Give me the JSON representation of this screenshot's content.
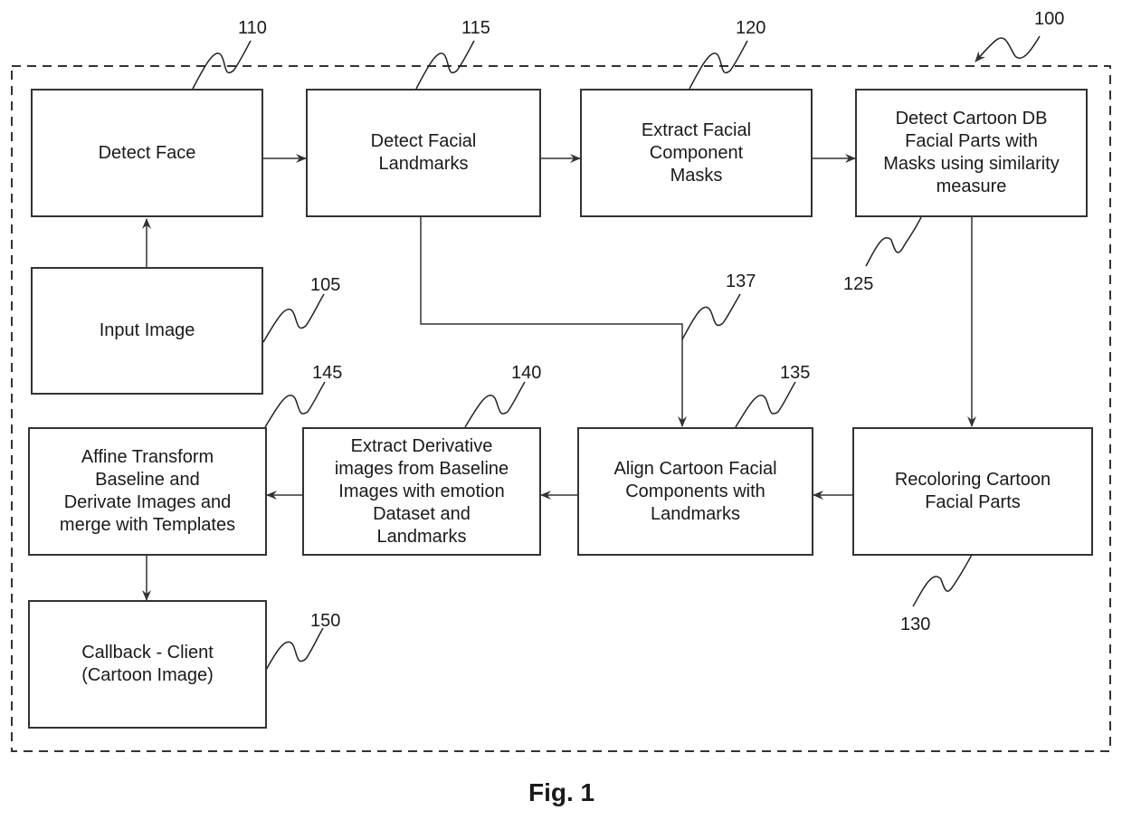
{
  "figure": {
    "caption": "Fig. 1",
    "system_ref": "100",
    "nodes": [
      {
        "id": "110",
        "label": "Detect Face"
      },
      {
        "id": "115",
        "label": "Detect Facial\nLandmarks"
      },
      {
        "id": "120",
        "label": "Extract Facial\nComponent\nMasks"
      },
      {
        "id": "125",
        "label": "Detect Cartoon DB\nFacial Parts with\nMasks using similarity\nmeasure"
      },
      {
        "id": "105",
        "label": "Input Image"
      },
      {
        "id": "145",
        "label": "Affine Transform\nBaseline and\nDerivate Images and\nmerge with Templates"
      },
      {
        "id": "140",
        "label": "Extract Derivative\nimages from Baseline\nImages with emotion\nDataset and\nLandmarks"
      },
      {
        "id": "135",
        "label": "Align Cartoon Facial\nComponents with\nLandmarks"
      },
      {
        "id": "130",
        "label": "Recoloring Cartoon\nFacial Parts"
      },
      {
        "id": "150",
        "label": "Callback - Client\n(Cartoon Image)"
      }
    ],
    "refs": [
      "110",
      "115",
      "120",
      "100",
      "125",
      "105",
      "137",
      "145",
      "140",
      "135",
      "130",
      "150"
    ],
    "edges": [
      {
        "from": "105",
        "to": "110"
      },
      {
        "from": "110",
        "to": "115"
      },
      {
        "from": "115",
        "to": "120"
      },
      {
        "from": "120",
        "to": "125"
      },
      {
        "from": "125",
        "to": "130"
      },
      {
        "from": "115",
        "to": "135",
        "ref": "137"
      },
      {
        "from": "130",
        "to": "135"
      },
      {
        "from": "135",
        "to": "140"
      },
      {
        "from": "140",
        "to": "145"
      },
      {
        "from": "145",
        "to": "150"
      }
    ]
  }
}
